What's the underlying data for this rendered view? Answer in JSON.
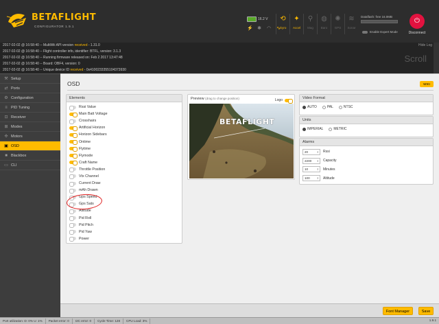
{
  "header": {
    "logo_name": "BETAFLIGHT",
    "logo_sub": "CONFIGURATOR 1.9.1",
    "battery_voltage": "16.2 V",
    "status_icons": [
      "link-icon",
      "gear-icon",
      "wifi-icon",
      "signal-icon"
    ],
    "sensors": [
      {
        "label": "Gyro",
        "glyph": "⟲",
        "active": true
      },
      {
        "label": "Accel",
        "glyph": "✦",
        "active": true
      },
      {
        "label": "Mag",
        "glyph": "⚲",
        "active": false
      },
      {
        "label": "Baro",
        "glyph": "◍",
        "active": false
      },
      {
        "label": "GPS",
        "glyph": "✺",
        "active": false
      },
      {
        "label": "Sonar",
        "glyph": "≋",
        "active": false
      }
    ],
    "dataflash": "Dataflash: free 16.0MB",
    "expert_mode": "Enable Expert Mode",
    "disconnect": "Disconnect"
  },
  "log": {
    "lines": [
      {
        "pre": "2017-02-02 @ 16:58:40 -- MultiWii API version ",
        "hl": "received",
        "post": " - 1.31.0"
      },
      {
        "pre": "2017-02-02 @ 16:58:40 -- Flight controller info, identifier: BTFL, version: 3.1.3",
        "hl": "",
        "post": ""
      },
      {
        "pre": "2017-02-02 @ 16:58:40 -- Running firmware released on: Feb 2 2017 13:47:48",
        "hl": "",
        "post": ""
      },
      {
        "pre": "2017-02-02 @ 16:58:40 -- Board: OBF4, version: 0",
        "hl": "",
        "post": ""
      },
      {
        "pre": "2017-02-02 @ 16:58:40 -- Unique device ID ",
        "hl": "received",
        "post": " - 0x4100233355104373930"
      }
    ],
    "hide_label": "Hide Log",
    "scroll_watermark": "Scroll"
  },
  "sidebar": {
    "items": [
      {
        "label": "Setup",
        "icon": "⚒",
        "active": false
      },
      {
        "label": "Ports",
        "icon": "⇄",
        "active": false
      },
      {
        "label": "Configuration",
        "icon": "⚙",
        "active": false
      },
      {
        "label": "PID Tuning",
        "icon": "≡",
        "active": false
      },
      {
        "label": "Receiver",
        "icon": "⊡",
        "active": false
      },
      {
        "label": "Modes",
        "icon": "⊞",
        "active": false
      },
      {
        "label": "Motors",
        "icon": "✣",
        "active": false
      },
      {
        "label": "OSD",
        "icon": "▣",
        "active": true
      },
      {
        "label": "Blackbox",
        "icon": "■",
        "active": false
      },
      {
        "label": "CLI",
        "icon": "▭",
        "active": false
      }
    ]
  },
  "main": {
    "title": "OSD",
    "wiki": "WIKI",
    "elements": {
      "header": "Elements",
      "items": [
        {
          "label": "Rssi Value",
          "on": false
        },
        {
          "label": "Main Batt Voltage",
          "on": true
        },
        {
          "label": "Crosshairs",
          "on": false
        },
        {
          "label": "Artificial Horizon",
          "on": true
        },
        {
          "label": "Horizon Sidebars",
          "on": true
        },
        {
          "label": "Ontime",
          "on": true
        },
        {
          "label": "Flytime",
          "on": true
        },
        {
          "label": "Flymode",
          "on": true
        },
        {
          "label": "Craft Name",
          "on": true
        },
        {
          "label": "Throttle Position",
          "on": false
        },
        {
          "label": "Vtx Channel",
          "on": false
        },
        {
          "label": "Current Draw",
          "on": false
        },
        {
          "label": "mAh Drawn",
          "on": false
        },
        {
          "label": "Gps Speed",
          "on": false
        },
        {
          "label": "Gps Sats",
          "on": false
        },
        {
          "label": "Altitude",
          "on": false
        },
        {
          "label": "Pid Roll",
          "on": false
        },
        {
          "label": "Pid Pitch",
          "on": false
        },
        {
          "label": "Pid Yaw",
          "on": false
        },
        {
          "label": "Power",
          "on": false
        }
      ]
    },
    "preview": {
      "header": "Preview",
      "sub": "(drag to change position)",
      "logo_label": "Logo",
      "osd_logo": "BETAFLIGHT"
    },
    "video_format": {
      "header": "Video Format",
      "options": [
        {
          "label": "AUTO",
          "selected": true
        },
        {
          "label": "PAL",
          "selected": false
        },
        {
          "label": "NTSC",
          "selected": false
        }
      ]
    },
    "units": {
      "header": "Units",
      "options": [
        {
          "label": "IMPERIAL",
          "selected": true
        },
        {
          "label": "METRIC",
          "selected": false
        }
      ]
    },
    "alarms": {
      "header": "Alarms",
      "rows": [
        {
          "value": "20",
          "label": "Rssi"
        },
        {
          "value": "2200",
          "label": "Capacity"
        },
        {
          "value": "10",
          "label": "Minutes"
        },
        {
          "value": "100",
          "label": "Altitude"
        }
      ]
    }
  },
  "toolbar": {
    "font_manager": "Font Manager",
    "save": "Save"
  },
  "statusbar": {
    "items": [
      "Port utilization: D: 0% U: 1%",
      "Packet error: 0",
      "I2C error: 0",
      "Cycle Time: 128",
      "CPU Load: 3%"
    ],
    "version": "1.9.1"
  },
  "colors": {
    "accent": "#ffbb00",
    "disconnect": "#e2123f",
    "annotation": "#e02020"
  }
}
